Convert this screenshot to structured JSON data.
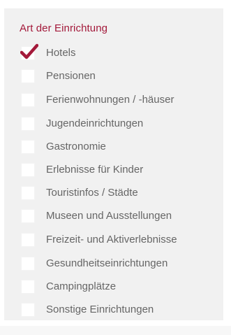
{
  "filter": {
    "title": "Art der Einrichtung",
    "accent_color": "#a3193a",
    "options": [
      {
        "label": "Hotels",
        "checked": true
      },
      {
        "label": "Pensionen",
        "checked": false
      },
      {
        "label": "Ferienwohnungen / -häuser",
        "checked": false
      },
      {
        "label": "Jugendeinrichtungen",
        "checked": false
      },
      {
        "label": "Gastronomie",
        "checked": false
      },
      {
        "label": "Erlebnisse für Kinder",
        "checked": false
      },
      {
        "label": "Touristinfos / Städte",
        "checked": false
      },
      {
        "label": "Museen und Ausstellungen",
        "checked": false
      },
      {
        "label": "Freizeit- und Aktiverlebnisse",
        "checked": false
      },
      {
        "label": "Gesundheitseinrichtungen",
        "checked": false
      },
      {
        "label": "Campingplätze",
        "checked": false
      },
      {
        "label": "Sonstige Einrichtungen",
        "checked": false
      }
    ]
  }
}
